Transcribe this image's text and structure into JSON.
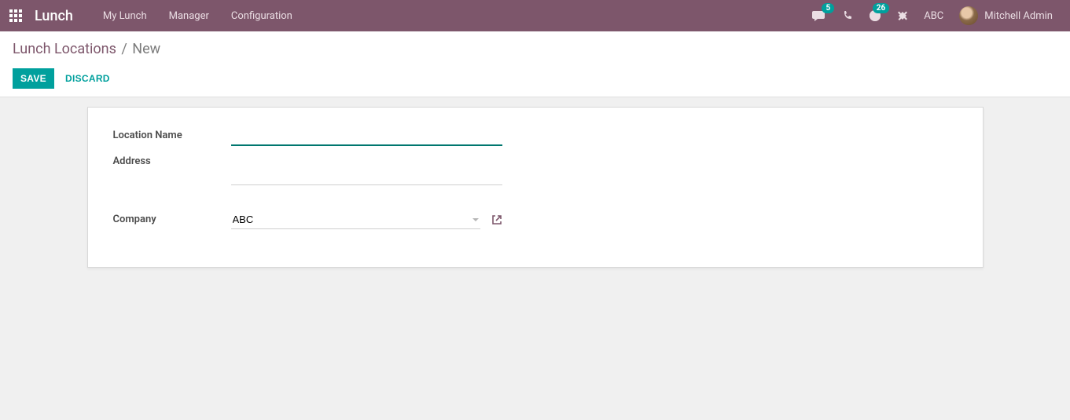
{
  "navbar": {
    "brand": "Lunch",
    "menu": [
      "My Lunch",
      "Manager",
      "Configuration"
    ],
    "messages_badge": "5",
    "activities_badge": "26",
    "company": "ABC",
    "user": "Mitchell Admin"
  },
  "breadcrumb": {
    "parent": "Lunch Locations",
    "current": "New"
  },
  "buttons": {
    "save": "SAVE",
    "discard": "DISCARD"
  },
  "form": {
    "location_name": {
      "label": "Location Name",
      "value": ""
    },
    "address": {
      "label": "Address",
      "value": ""
    },
    "company": {
      "label": "Company",
      "value": "ABC"
    }
  }
}
